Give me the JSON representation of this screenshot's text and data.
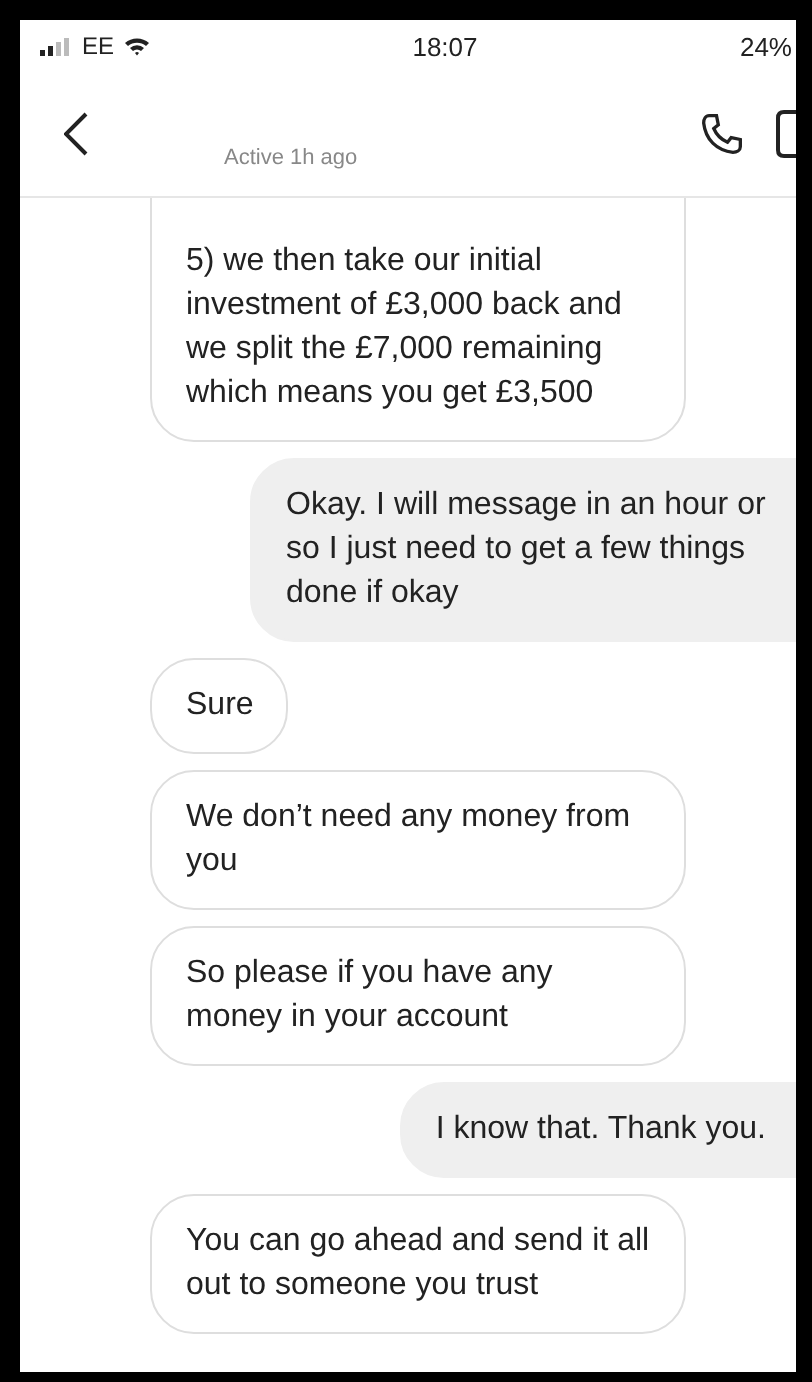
{
  "status_bar": {
    "carrier": "EE",
    "time": "18:07",
    "battery": "24%"
  },
  "header": {
    "status": "Active 1h ago"
  },
  "messages": [
    {
      "kind": "received",
      "text": "5) we then take our initial investment of £3,000 back and we split the £7,000 remaining which means you get £3,500"
    },
    {
      "kind": "sent",
      "text": "Okay. I will message in an hour or so I just need to get a few things done if okay"
    },
    {
      "kind": "received",
      "text": "Sure"
    },
    {
      "kind": "received",
      "text": "We don’t need any money from you"
    },
    {
      "kind": "received",
      "text": "So please if you have any money in your account"
    },
    {
      "kind": "sent",
      "text": "I know that. Thank you."
    },
    {
      "kind": "received",
      "text": "You can go ahead and send it all out to someone you trust"
    }
  ]
}
